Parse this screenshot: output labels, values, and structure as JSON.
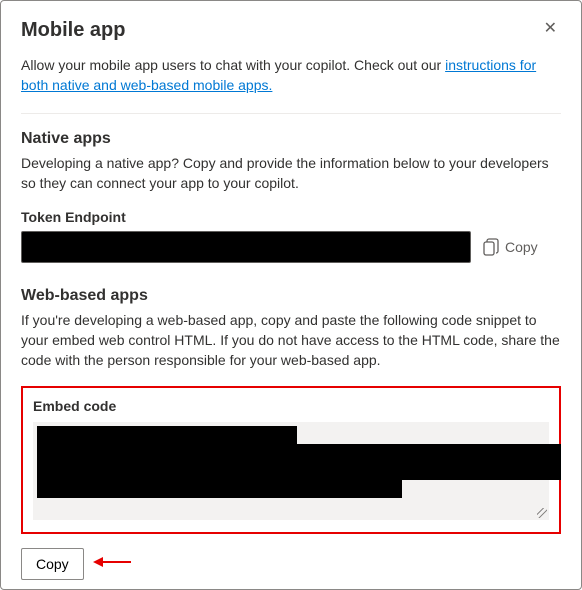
{
  "header": {
    "title": "Mobile app"
  },
  "intro": {
    "pre_text": "Allow your mobile app users to chat with your copilot. Check out our ",
    "link_text": "instructions for both native and web-based mobile apps."
  },
  "native": {
    "title": "Native apps",
    "desc": "Developing a native app? Copy and provide the information below to your developers so they can connect your app to your copilot.",
    "token_label": "Token Endpoint",
    "token_value": "",
    "copy_label": "Copy"
  },
  "web": {
    "title": "Web-based apps",
    "desc": "If you're developing a web-based app, copy and paste the following code snippet to your embed web control HTML. If you do not have access to the HTML code, share the code with the person responsible for your web-based app.",
    "embed_label": "Embed code",
    "embed_value": "",
    "copy_button": "Copy"
  }
}
